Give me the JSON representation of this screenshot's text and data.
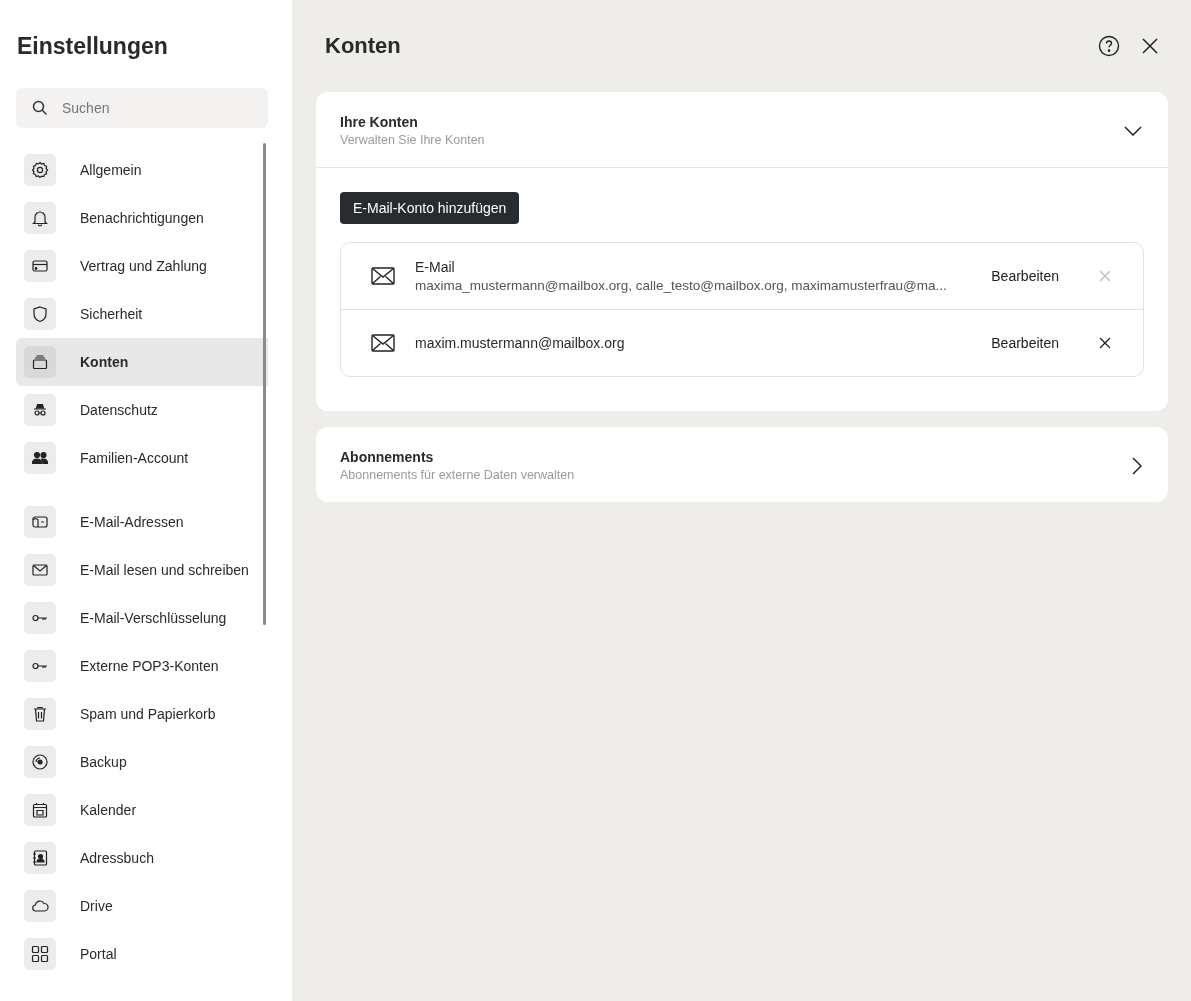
{
  "sidebar": {
    "title": "Einstellungen",
    "search": {
      "placeholder": "Suchen"
    },
    "groups": [
      [
        {
          "label": "Allgemein",
          "selected": false
        },
        {
          "label": "Benachrichtigungen",
          "selected": false
        },
        {
          "label": "Vertrag und Zahlung",
          "selected": false
        },
        {
          "label": "Sicherheit",
          "selected": false
        },
        {
          "label": "Konten",
          "selected": true
        },
        {
          "label": "Datenschutz",
          "selected": false
        },
        {
          "label": "Familien-Account",
          "selected": false
        }
      ],
      [
        {
          "label": "E-Mail-Adressen",
          "selected": false
        },
        {
          "label": "E-Mail lesen und schreiben",
          "selected": false
        },
        {
          "label": "E-Mail-Verschlüsselung",
          "selected": false
        },
        {
          "label": "Externe POP3-Konten",
          "selected": false
        },
        {
          "label": "Spam und Papierkorb",
          "selected": false
        },
        {
          "label": "Backup",
          "selected": false
        },
        {
          "label": "Kalender",
          "selected": false
        },
        {
          "label": "Adressbuch",
          "selected": false
        },
        {
          "label": "Drive",
          "selected": false
        },
        {
          "label": "Portal",
          "selected": false
        }
      ]
    ]
  },
  "main": {
    "title": "Konten",
    "sections": [
      {
        "title": "Ihre Konten",
        "subtitle": "Verwalten Sie Ihre Konten",
        "expanded": true,
        "add_button": "E-Mail-Konto hinzufügen",
        "accounts": [
          {
            "title": "E-Mail",
            "addresses": "maxima_mustermann@mailbox.org, calle_testo@mailbox.org, maximamusterfrau@ma...",
            "edit": "Bearbeiten",
            "remove_disabled": true
          },
          {
            "addresses": "maxim.mustermann@mailbox.org",
            "edit": "Bearbeiten",
            "remove_disabled": false
          }
        ]
      },
      {
        "title": "Abonnements",
        "subtitle": "Abonnements für externe Daten verwalten",
        "expanded": false
      }
    ]
  }
}
